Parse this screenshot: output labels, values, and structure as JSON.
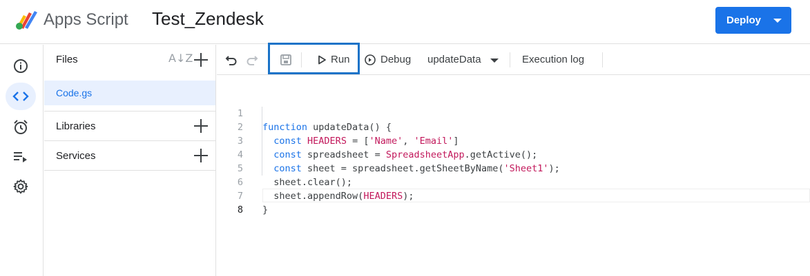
{
  "header": {
    "app_name": "Apps Script",
    "project_name": "Test_Zendesk",
    "deploy_label": "Deploy"
  },
  "rail": {
    "items": [
      "info-icon",
      "code-icon",
      "alarm-icon",
      "executions-icon",
      "gear-icon"
    ],
    "active": "code-icon"
  },
  "files": {
    "title": "Files",
    "items": [
      {
        "name": "Code.gs"
      }
    ],
    "sections": [
      {
        "label": "Libraries"
      },
      {
        "label": "Services"
      }
    ]
  },
  "toolbar": {
    "run_label": "Run",
    "debug_label": "Debug",
    "function_select": "updateData",
    "execution_log_label": "Execution log"
  },
  "editor": {
    "line_numbers": [
      "1",
      "2",
      "3",
      "4",
      "5",
      "6",
      "7",
      "8"
    ],
    "lines": [
      "function updateData() {",
      "  const HEADERS = ['Name', 'Email']",
      "  const spreadsheet = SpreadsheetApp.getActive();",
      "  const sheet = spreadsheet.getSheetByName('Sheet1');",
      "  sheet.clear();",
      "  sheet.appendRow(HEADERS);",
      "}",
      ""
    ]
  },
  "colors": {
    "accent": "#1a73e8",
    "highlight_border": "#1a73c8",
    "string": "#c2185b"
  }
}
